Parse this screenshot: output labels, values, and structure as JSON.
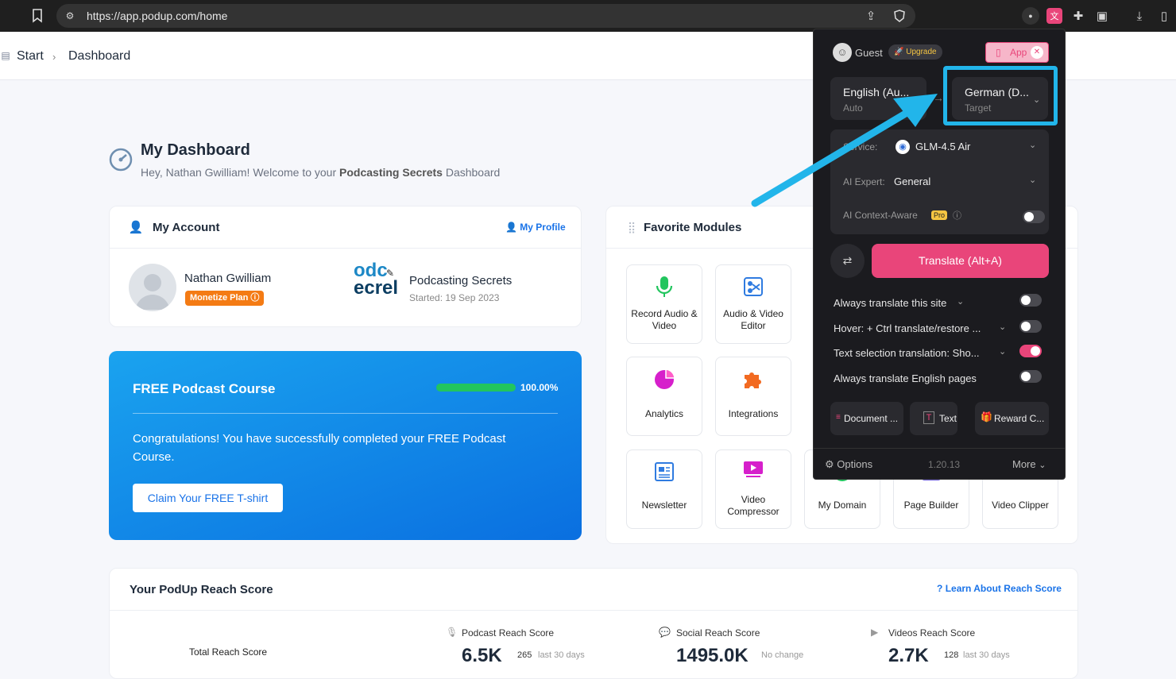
{
  "browser": {
    "url": "https://app.podup.com/home"
  },
  "breadcrumb": {
    "start": "Start",
    "current": "Dashboard"
  },
  "dashboard": {
    "title": "My Dashboard",
    "greeting_prefix": "Hey, Nathan Gwilliam! Welcome to your ",
    "greeting_bold": "Podcasting Secrets",
    "greeting_suffix": " Dashboard"
  },
  "account": {
    "title": "My Account",
    "profile_link": "My Profile",
    "user_name": "Nathan Gwilliam",
    "plan_badge": "Monetize Plan",
    "podcast_logo_text_1": "odc",
    "podcast_logo_text_2": "ecrel",
    "podcast_name": "Podcasting Secrets",
    "podcast_started": "Started: 19 Sep 2023"
  },
  "course": {
    "title": "FREE Podcast Course",
    "progress_label": "100.00%",
    "progress": 1.0,
    "message": "Congratulations! You have successfully completed your FREE Podcast Course.",
    "button": "Claim Your FREE T-shirt"
  },
  "modules": {
    "title": "Favorite Modules",
    "items": [
      {
        "label": "Record Audio & Video",
        "icon": "microphone-icon"
      },
      {
        "label": "Audio & Video Editor",
        "icon": "editor-icon"
      },
      {
        "label": "Analytics",
        "icon": "pie-chart-icon"
      },
      {
        "label": "Integrations",
        "icon": "puzzle-icon"
      },
      {
        "label": "Newsletter",
        "icon": "newsletter-icon"
      },
      {
        "label": "Video Compressor",
        "icon": "compress-icon"
      },
      {
        "label": "My Domain",
        "icon": "globe-icon"
      },
      {
        "label": "Page Builder",
        "icon": "page-builder-icon"
      },
      {
        "label": "Video Clipper",
        "icon": "clipper-icon"
      }
    ]
  },
  "reach": {
    "title": "Your PodUp Reach Score",
    "learn_link": "Learn About Reach Score",
    "total_label": "Total Reach Score",
    "podcast": {
      "label": "Podcast Reach Score",
      "value": "6.5K",
      "delta": "265",
      "delta_note": "last 30 days"
    },
    "social": {
      "label": "Social Reach Score",
      "value": "1495.0K",
      "delta_note": "No change"
    },
    "videos": {
      "label": "Videos Reach Score",
      "value": "2.7K",
      "delta": "128",
      "delta_note": "last 30 days"
    }
  },
  "translator": {
    "user": "Guest",
    "upgrade": "Upgrade",
    "app_button": "App",
    "source_lang": "English (Au...",
    "source_sub": "Auto",
    "target_lang": "German (D...",
    "target_sub": "Target",
    "service_label": "Service:",
    "service_value": "GLM-4.5 Air",
    "expert_label": "AI Expert:",
    "expert_value": "General",
    "context_label": "AI Context-Aware",
    "pro_badge": "Pro",
    "translate_button": "Translate (Alt+A)",
    "settings": [
      {
        "label": "Always translate this site",
        "on": false
      },
      {
        "label": "Hover:  + Ctrl translate/restore ...",
        "on": false
      },
      {
        "label": "Text selection translation: Sho...",
        "on": true
      },
      {
        "label": "Always translate English pages",
        "on": false
      }
    ],
    "document_btn": "Document ...",
    "text_btn": "Text",
    "reward_btn": "Reward C...",
    "options": "Options",
    "version": "1.20.13",
    "more": "More",
    "accent_color": "#e9457a",
    "highlight_color": "#22b5ea"
  }
}
